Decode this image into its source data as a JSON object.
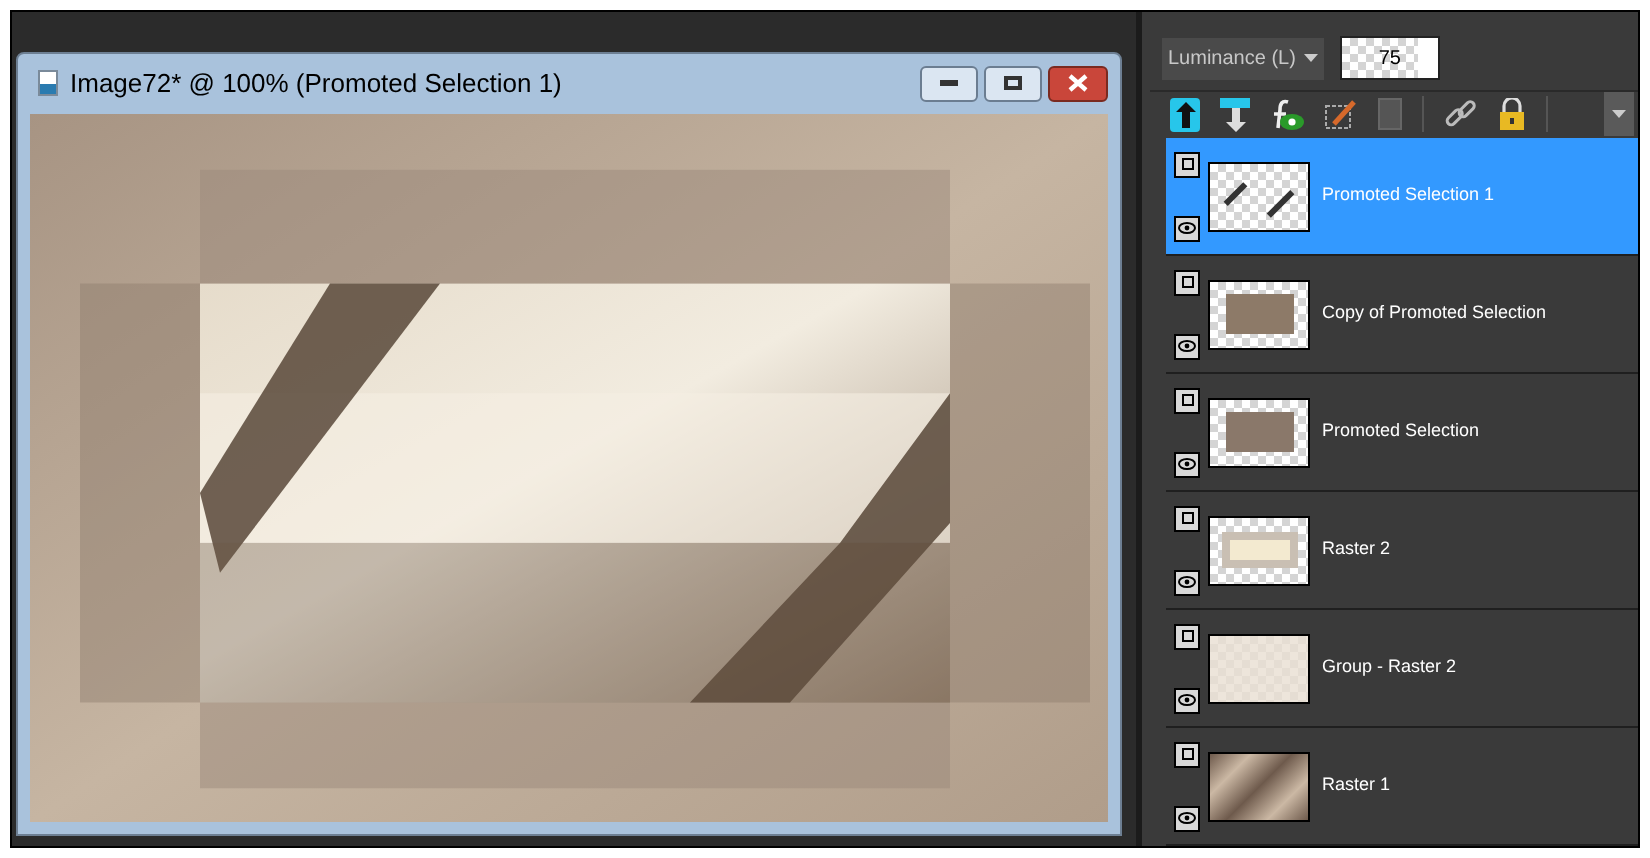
{
  "image_window": {
    "title": "Image72* @ 100% (Promoted Selection 1)"
  },
  "layers_panel": {
    "blend_mode": "Luminance (L)",
    "opacity": {
      "reading": "75",
      "level": 0.8
    },
    "layers": [
      {
        "name": "Promoted Selection 1",
        "selected": true
      },
      {
        "name": "Copy of Promoted Selection",
        "selected": false
      },
      {
        "name": "Promoted Selection",
        "selected": false
      },
      {
        "name": "Raster 2",
        "selected": false
      },
      {
        "name": "Group - Raster 2",
        "selected": false
      },
      {
        "name": "Raster 1",
        "selected": false
      }
    ]
  }
}
